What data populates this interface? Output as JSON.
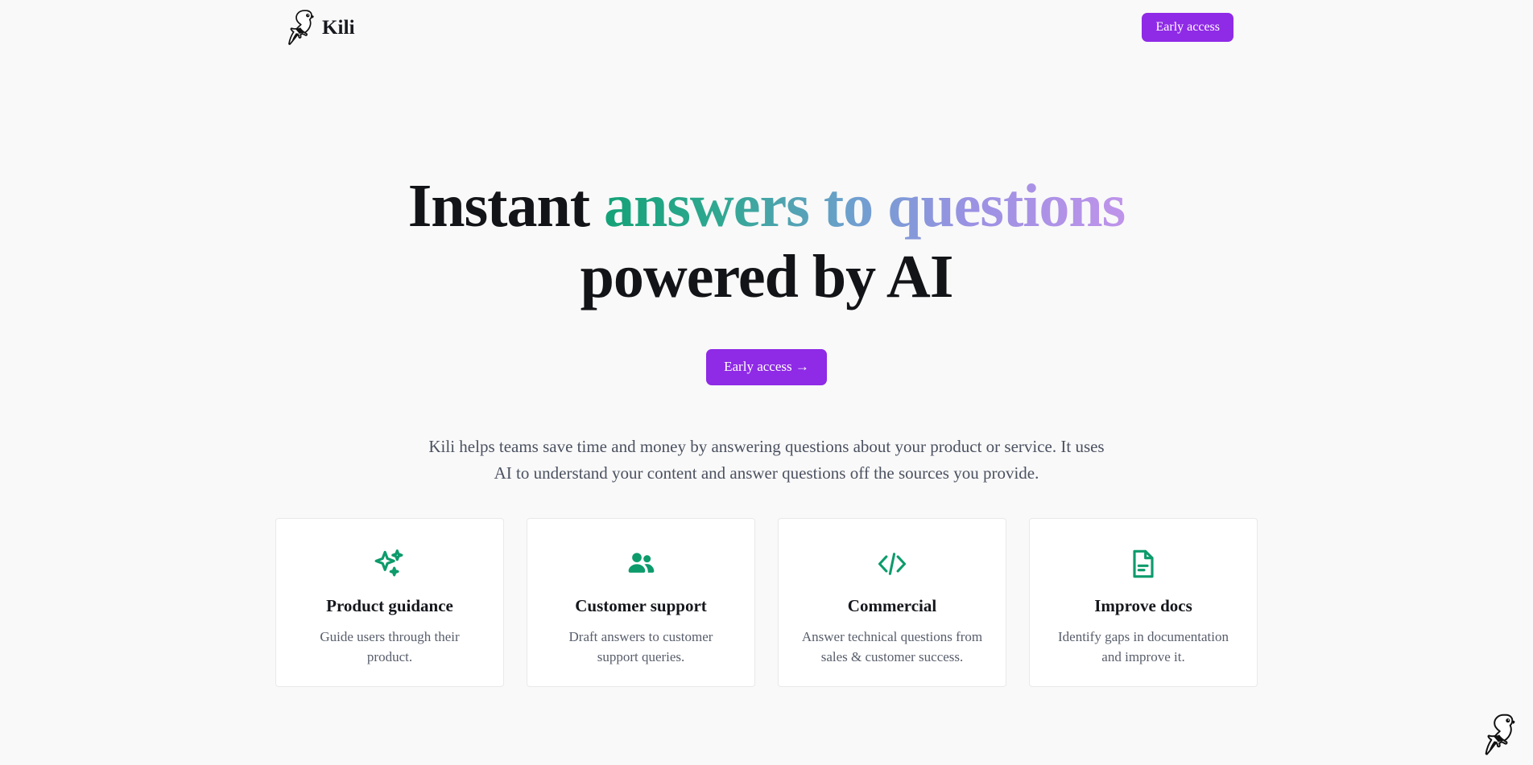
{
  "page": {
    "background_color": "#f9f9f9",
    "accent_purple": "#8f2ae6",
    "accent_green": "#0d9b6c"
  },
  "header": {
    "brand": {
      "name": "Kili",
      "logo_icon": "parrot-logo-icon"
    },
    "early_access_label": "Early access"
  },
  "hero": {
    "headline_plain": "Instant ",
    "headline_gradient": "answers to questions",
    "headline_line2": "powered by AI",
    "gradient_start_color": "#14a277",
    "gradient_mid_color": "#6f9fcf",
    "gradient_end_color": "#bf93ea",
    "cta_label": "Early access →",
    "subtitle": "Kili helps teams save time and money by answering questions about your product or service. It uses AI to understand your content and answer questions off the sources you provide."
  },
  "cards": [
    {
      "icon": "sparkles-icon",
      "title": "Product guidance",
      "description": "Guide users through their product."
    },
    {
      "icon": "users-icon",
      "title": "Customer support",
      "description": "Draft answers to customer support queries."
    },
    {
      "icon": "code-brackets-icon",
      "title": "Commercial",
      "description": "Answer technical questions from sales & customer success."
    },
    {
      "icon": "document-icon",
      "title": "Improve docs",
      "description": "Identify gaps in documentation and improve it."
    }
  ],
  "corner_badge": {
    "icon": "parrot-badge-icon"
  }
}
